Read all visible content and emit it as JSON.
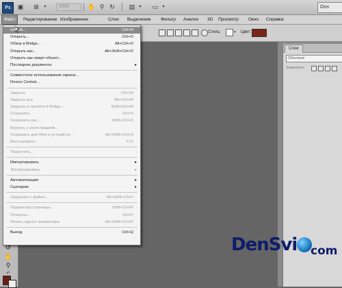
{
  "app": {
    "logo": "Ps",
    "zoom": "100%",
    "workspace": "Осн"
  },
  "menubar": [
    "Файл",
    "Редактирование",
    "Изображение",
    "Слои",
    "Выделение",
    "Фильтр",
    "Анализ",
    "3D",
    "Просмотр",
    "Окно",
    "Справка"
  ],
  "options": {
    "style_label": "Стиль:",
    "color_label": "Цвет:",
    "color_value": "#7b2418"
  },
  "layers_panel": {
    "tab": "Слои",
    "blend_mode": "Обычные",
    "lock_label": "Закрепить:"
  },
  "file_menu": [
    {
      "label": "Новый...",
      "shortcut": "Ctrl+N",
      "disabled": false,
      "highlight": true
    },
    {
      "label": "Открыть...",
      "shortcut": "Ctrl+O",
      "disabled": false
    },
    {
      "label": "Обзор в Bridge...",
      "shortcut": "Alt+Ctrl+O",
      "disabled": false
    },
    {
      "label": "Открыть как...",
      "shortcut": "Alt+Shift+Ctrl+O",
      "disabled": false
    },
    {
      "label": "Открыть как смарт-объект...",
      "shortcut": "",
      "disabled": false
    },
    {
      "label": "Последние документы",
      "shortcut": "",
      "disabled": false,
      "submenu": true
    },
    {
      "sep": true
    },
    {
      "label": "Совместное использование экрана...",
      "shortcut": "",
      "disabled": false
    },
    {
      "label": "Device Central...",
      "shortcut": "",
      "disabled": false
    },
    {
      "sep": true
    },
    {
      "label": "Закрыть",
      "shortcut": "Ctrl+W",
      "disabled": true
    },
    {
      "label": "Закрыть все",
      "shortcut": "Alt+Ctrl+W",
      "disabled": true
    },
    {
      "label": "Закрыть и перейти в Bridge...",
      "shortcut": "Shift+Ctrl+W",
      "disabled": true
    },
    {
      "label": "Сохранить",
      "shortcut": "Ctrl+S",
      "disabled": true
    },
    {
      "label": "Сохранить как...",
      "shortcut": "Shift+Ctrl+S",
      "disabled": true
    },
    {
      "label": "Вернуть с регистрацией...",
      "shortcut": "",
      "disabled": true
    },
    {
      "label": "Сохранить для Web и устройств...",
      "shortcut": "Alt+Shift+Ctrl+S",
      "disabled": true
    },
    {
      "label": "Восстановить",
      "shortcut": "F12",
      "disabled": true
    },
    {
      "sep": true
    },
    {
      "label": "Поместить...",
      "shortcut": "",
      "disabled": true
    },
    {
      "sep": true
    },
    {
      "label": "Импортировать",
      "shortcut": "",
      "disabled": false,
      "submenu": true
    },
    {
      "label": "Экспортировать",
      "shortcut": "",
      "disabled": true,
      "submenu": true
    },
    {
      "sep": true
    },
    {
      "label": "Автоматизация",
      "shortcut": "",
      "disabled": false,
      "submenu": true
    },
    {
      "label": "Сценарии",
      "shortcut": "",
      "disabled": false,
      "submenu": true
    },
    {
      "sep": true
    },
    {
      "label": "Сведения о файле...",
      "shortcut": "Alt+Shift+Ctrl+I",
      "disabled": true
    },
    {
      "sep": true
    },
    {
      "label": "Параметры страницы...",
      "shortcut": "Shift+Ctrl+P",
      "disabled": true
    },
    {
      "label": "Печатать...",
      "shortcut": "Ctrl+P",
      "disabled": true
    },
    {
      "label": "Печать одного экземпляра",
      "shortcut": "Alt+Shift+Ctrl+P",
      "disabled": true
    },
    {
      "sep": true
    },
    {
      "label": "Выход",
      "shortcut": "Ctrl+Q",
      "disabled": false
    }
  ],
  "watermark": {
    "text": "DenSvi",
    "suffix": "com"
  }
}
